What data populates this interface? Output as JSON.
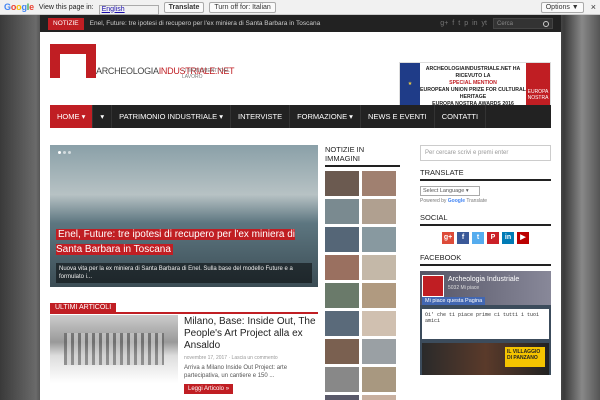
{
  "translate_bar": {
    "logo_letters": [
      "G",
      "o",
      "o",
      "g",
      "l",
      "e"
    ],
    "view_text": "View this page in:",
    "language": "English",
    "translate_button": "Translate",
    "turn_off_button": "Turn off for: Italian",
    "close_label": "×",
    "options_button": "Options ▼"
  },
  "topbar": {
    "tag": "NOTIZIE",
    "ticker": "Enel, Future: tre ipotesi di recupero per l'ex miniera di Santa Barbara in Toscana",
    "social_icons": [
      "g+",
      "f",
      "t",
      "p",
      "in",
      "yt"
    ],
    "search_placeholder": "Cerca"
  },
  "site": {
    "name_part1": "ARCHEOLOGIA",
    "name_part2": "INDUSTRIALE.NET",
    "motto": "• I MONUMENTI DEL LAVORO"
  },
  "banner": {
    "line1": "ARCHEOLOGIAINDUSTRIALE.NET HA RICEVUTO LA",
    "line2": "SPECIAL MENTION",
    "line3": "EUROPEAN UNION PRIZE FOR CULTURAL HERITAGE",
    "line4": "EUROPA NOSTRA AWARDS 2016",
    "right_label": "EUROPA NOSTRA"
  },
  "nav": {
    "items": [
      {
        "label": "HOME ▾"
      },
      {
        "label": "▾"
      },
      {
        "label": "PATRIMONIO INDUSTRIALE ▾"
      },
      {
        "label": "INTERVISTE"
      },
      {
        "label": "FORMAZIONE ▾"
      },
      {
        "label": "NEWS E EVENTI"
      },
      {
        "label": "CONTATTI"
      }
    ]
  },
  "slider": {
    "title": "Enel, Future: tre ipotesi di recupero per l'ex miniera di Santa Barbara in Toscana",
    "excerpt": "Nuova vita per la ex miniera di Santa Barbara di Enel. Sulla base del modello Future e a formulato i..."
  },
  "images_section": {
    "title": "NOTIZIE IN IMMAGINI",
    "thumb_colors": [
      "#6b5a50",
      "#a08070",
      "#7a8a90",
      "#b0a090",
      "#556677",
      "#8899a0",
      "#9a7060",
      "#c4b8a8",
      "#6a7a6a",
      "#b09a80",
      "#5a6a7a",
      "#d0c0b0",
      "#7a6050",
      "#9aa0a4",
      "#888",
      "#a89880",
      "#5a5a6a",
      "#c8b0a0"
    ]
  },
  "latest": {
    "title": "ULTIMI ARTICOLI",
    "article": {
      "title": "Milano, Base: Inside Out, The People's Art Project alla ex Ansaldo",
      "date": "novembre 17, 2017",
      "comments": "Lascia un commento",
      "excerpt": "Arriva a Milano Inside Out Project: arte partecipativa, un cantiere e 150 ...",
      "more": "Leggi Articolo »"
    }
  },
  "sidebar": {
    "search_placeholder": "Per cercare scrivi e premi enter",
    "translate_title": "TRANSLATE",
    "select_language": "Select Language ▾",
    "powered_prefix": "Powered by",
    "powered_google": "Google",
    "powered_suffix": "Translate",
    "social_title": "SOCIAL",
    "social_buttons": [
      {
        "label": "g+",
        "color": "#dd4b39"
      },
      {
        "label": "f",
        "color": "#3b5998"
      },
      {
        "label": "t",
        "color": "#55acee"
      },
      {
        "label": "P",
        "color": "#cb2027"
      },
      {
        "label": "in",
        "color": "#007bb5"
      },
      {
        "label": "▶",
        "color": "#bb0000"
      }
    ],
    "facebook_title": "FACEBOOK",
    "fb_name": "Archeologia Industriale",
    "fb_likes": "5032 Mi piace",
    "fb_like_button": "Mi piace questa Pagina",
    "fb_post": "Oi' che ti piace prime ci tutti i tuoi amici",
    "fb_photo_label": "IL VILLAGGIO DI PANZANO"
  }
}
